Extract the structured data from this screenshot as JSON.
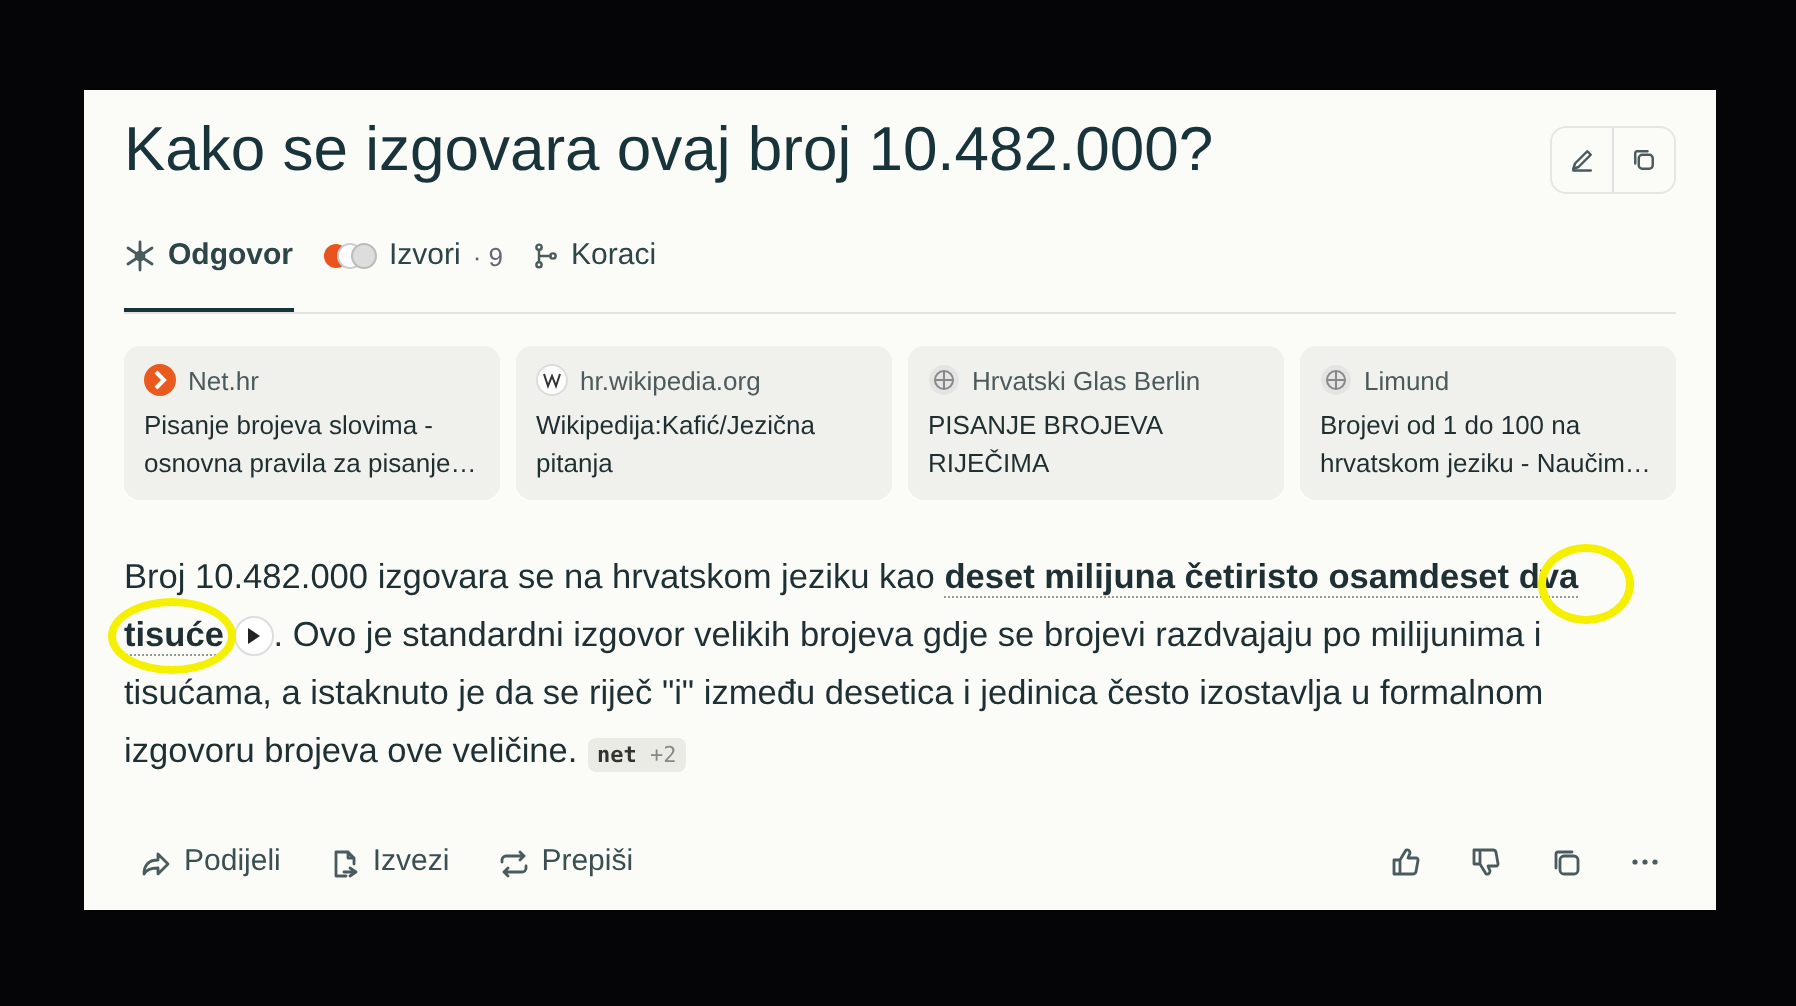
{
  "question": {
    "title": "Kako se izgovara ovaj broj 10.482.000?"
  },
  "tabs": [
    {
      "label": "Odgovor",
      "kind": "answer",
      "selected": true
    },
    {
      "label": "Izvori",
      "count": "· 9",
      "kind": "sources",
      "selected": false
    },
    {
      "label": "Koraci",
      "kind": "steps",
      "selected": false
    }
  ],
  "sources": [
    {
      "site": "Net.hr",
      "kind": "arrow",
      "title": "Pisanje brojeva slovima - osnovna pravila za pisanje…"
    },
    {
      "site": "hr.wikipedia.org",
      "kind": "wiki",
      "title": "Wikipedija:Kafić/Jezična pitanja"
    },
    {
      "site": "Hrvatski Glas Berlin",
      "kind": "globe",
      "title": "PISANJE BROJEVA RIJEČIMA"
    },
    {
      "site": "Limund",
      "kind": "globe",
      "title": "Brojevi od 1 do 100 na hrvatskom jeziku - Naučim…"
    }
  ],
  "answer": {
    "before": "Broj 10.482.000 izgovara se na hrvatskom jeziku kao **deset milijuna četiristo osamdeset dva tisuće**",
    "after": ". Ovo je standardni izgovor velikih brojeva gdje se brojevi razdvajaju po milijunima i tisućama, a istaknuto je da se riječ \"i\" između desetica i jedinica često izostavlja u formalnom izgovoru brojeva ove veličine.",
    "citation": "net",
    "citation_more": "+2"
  },
  "actions": [
    {
      "label": "Podijeli",
      "kind": "share"
    },
    {
      "label": "Izvezi",
      "kind": "export"
    },
    {
      "label": "Prepiši",
      "kind": "rewrite"
    }
  ],
  "feedback": [
    {
      "kind": "like"
    },
    {
      "kind": "dislike"
    },
    {
      "kind": "copy"
    },
    {
      "kind": "more"
    }
  ]
}
